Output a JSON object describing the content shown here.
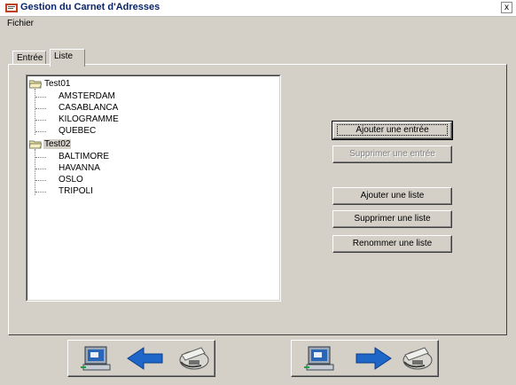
{
  "window": {
    "title": "Gestion du Carnet d'Adresses",
    "close_label": "x"
  },
  "menu": {
    "items": [
      "Fichier"
    ]
  },
  "tabs": [
    {
      "label": "Entrée"
    },
    {
      "label": "Liste"
    }
  ],
  "tree": {
    "groups": [
      {
        "name": "Test01",
        "entries": [
          "AMSTERDAM",
          "CASABLANCA",
          "KILOGRAMME",
          "QUEBEC"
        ]
      },
      {
        "name": "Test02",
        "entries": [
          "BALTIMORE",
          "HAVANNA",
          "OSLO",
          "TRIPOLI"
        ]
      }
    ]
  },
  "buttons": {
    "add_entry": "Ajouter une entrée",
    "remove_entry": "Supprimer une entrée",
    "add_list": "Ajouter une liste",
    "remove_list": "Supprimer une liste",
    "rename_list": "Renommer une liste"
  },
  "nav": {
    "left": {
      "icons": [
        "computer-icon",
        "arrow-left-icon",
        "fax-icon"
      ]
    },
    "right": {
      "icons": [
        "computer-icon",
        "arrow-right-icon",
        "fax-icon"
      ]
    }
  },
  "colors": {
    "title_text": "#0a246a",
    "arrow": "#1e66c8",
    "face": "#d4d0c8"
  }
}
